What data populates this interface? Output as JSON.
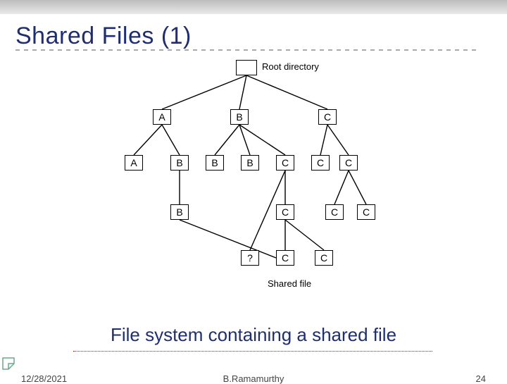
{
  "title": "Shared Files (1)",
  "caption": "File system containing a shared file",
  "footer": {
    "date": "12/28/2021",
    "author": "B.Ramamurthy",
    "page": "24"
  },
  "labels": {
    "root": "Root directory",
    "shared": "Shared file"
  },
  "tree": {
    "root": {
      "label": ""
    },
    "level1": [
      {
        "id": "A0",
        "label": "A"
      },
      {
        "id": "B0",
        "label": "B"
      },
      {
        "id": "C0",
        "label": "C"
      }
    ],
    "level2": [
      {
        "id": "A1",
        "parent": "A0",
        "label": "A"
      },
      {
        "id": "B1",
        "parent": "A0",
        "label": "B"
      },
      {
        "id": "B2",
        "parent": "B0",
        "label": "B"
      },
      {
        "id": "B3",
        "parent": "B0",
        "label": "B"
      },
      {
        "id": "C1",
        "parent": "B0",
        "label": "C"
      },
      {
        "id": "C2",
        "parent": "C0",
        "label": "C"
      },
      {
        "id": "C3",
        "parent": "C0",
        "label": "C"
      }
    ],
    "level3": [
      {
        "id": "B4",
        "parent": "B1",
        "label": "B"
      },
      {
        "id": "C4",
        "parent": "C1",
        "label": "C"
      },
      {
        "id": "Q",
        "parent": "C1",
        "label": "?"
      },
      {
        "id": "C5",
        "parent": "C3",
        "label": "C"
      },
      {
        "id": "C6",
        "parent": "C3",
        "label": "C"
      }
    ],
    "level4": [
      {
        "id": "C7",
        "parent": "C4",
        "label": "C"
      },
      {
        "id": "C8",
        "parent": "C4",
        "label": "C"
      }
    ],
    "shared_link": {
      "from": "B4",
      "to": "C7"
    }
  }
}
